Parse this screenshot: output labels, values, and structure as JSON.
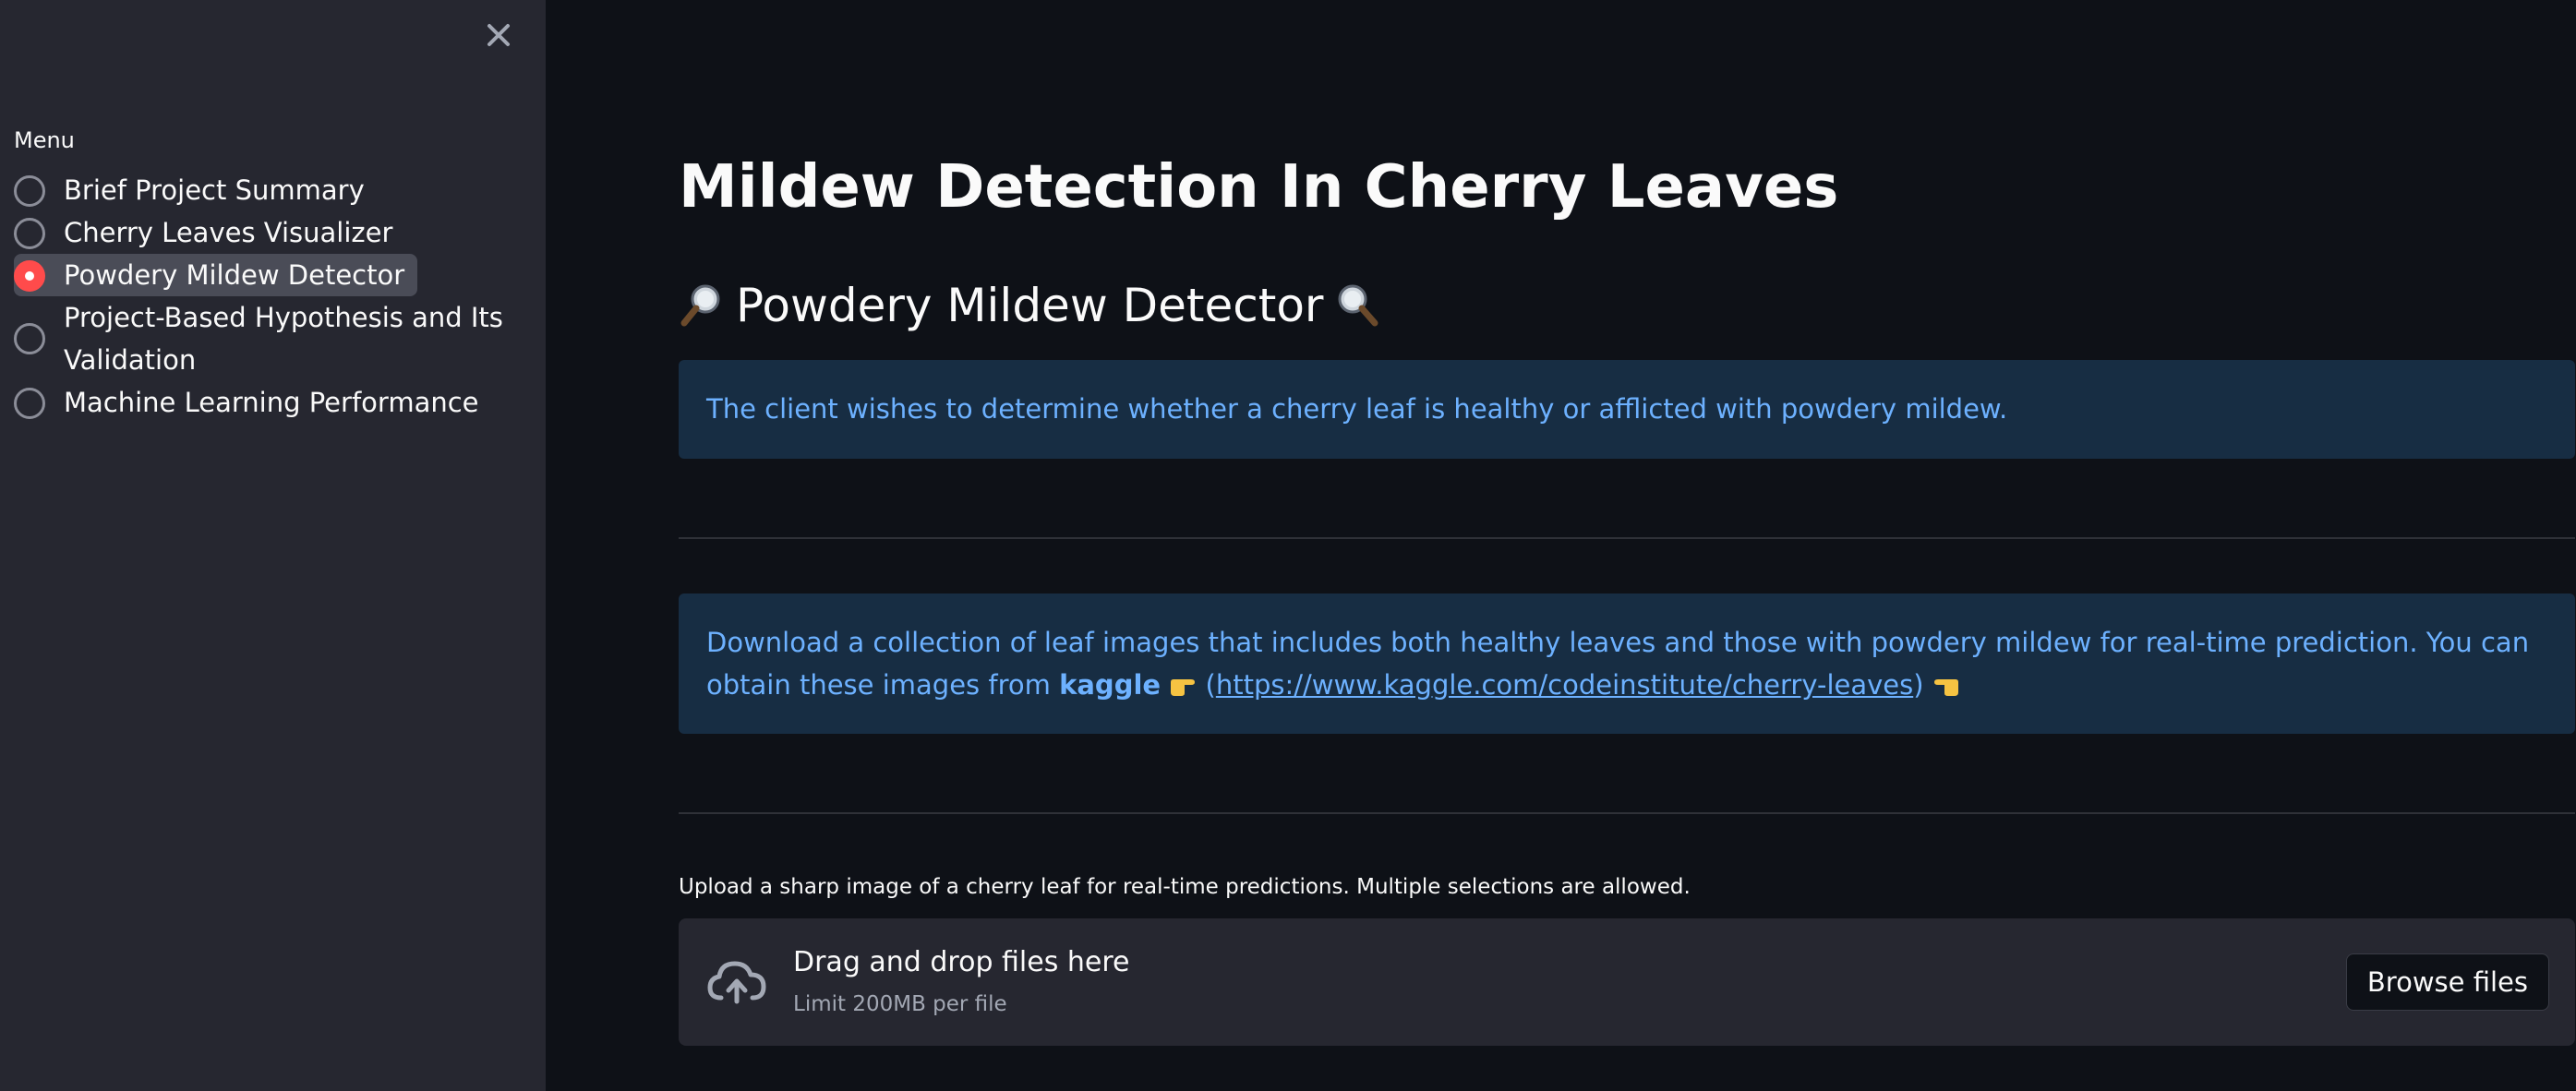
{
  "sidebar": {
    "menu_label": "Menu",
    "items": [
      {
        "label": "Brief Project Summary",
        "selected": false
      },
      {
        "label": "Cherry Leaves Visualizer",
        "selected": false
      },
      {
        "label": "Powdery Mildew Detector",
        "selected": true
      },
      {
        "label": "Project-Based Hypothesis and Its Validation",
        "selected": false
      },
      {
        "label": "Machine Learning Performance",
        "selected": false
      }
    ],
    "close_icon": "close-icon"
  },
  "main": {
    "title": "Mildew Detection In Cherry Leaves",
    "subheader": "Powdery Mildew Detector",
    "subheader_left_icon": "magnifier-left-icon",
    "subheader_right_icon": "magnifier-right-icon",
    "info_1": "The client wishes to determine whether a cherry leaf is healthy or afflicted with powdery mildew.",
    "info_2": {
      "text_before": "Download a collection of leaf images that includes both healthy leaves and those with powdery mildew for real-time prediction. You can obtain these images from ",
      "bold": "kaggle",
      "link_open": " (",
      "link_text": "https://www.kaggle.com/codeinstitute/cherry-leaves",
      "link_close": ")",
      "hand_right_icon": "pointing-right-icon",
      "hand_left_icon": "pointing-left-icon"
    },
    "uploader": {
      "label": "Upload a sharp image of a cherry leaf for real-time predictions. Multiple selections are allowed.",
      "drop_title": "Drag and drop files here",
      "limit": "Limit 200MB per file",
      "browse_label": "Browse files",
      "icon": "cloud-upload-icon"
    }
  },
  "colors": {
    "main_bg": "#0e1117",
    "sidebar_bg": "#262730",
    "accent": "#ff4b4b",
    "info_bg": "#172d43",
    "info_text": "#6db1ff"
  }
}
